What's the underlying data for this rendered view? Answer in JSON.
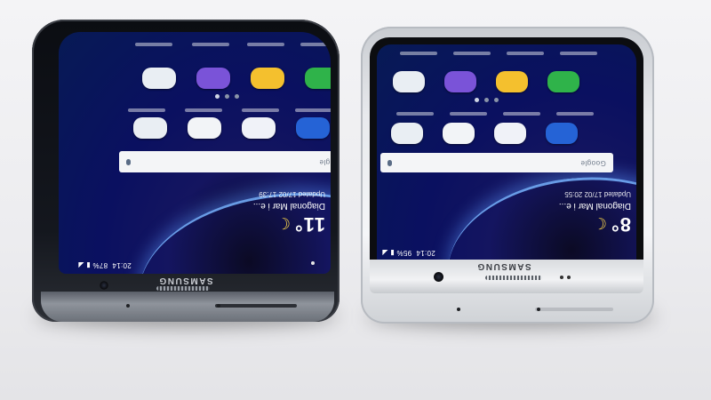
{
  "scene": {
    "description_tag": "two-smartphones-side-by-side"
  },
  "phone_left": {
    "brand": "SAMSUNG",
    "weather": {
      "temperature": "11°",
      "location": "Diagonal Mar i e...",
      "updated": "Updated 17/02 17:39"
    },
    "status": {
      "battery": "87%",
      "time": "20:14"
    },
    "search_logo": "Google",
    "icon_colors": [
      "#e9eef3",
      "#7a53d8",
      "#f4c02e",
      "#2fb34a"
    ],
    "dock_icon_colors": [
      "#e9eef3",
      "#f2f4f7",
      "#f0f2f8",
      "#2563d6"
    ]
  },
  "phone_right": {
    "brand": "SAMSUNG",
    "weather": {
      "temperature": "8°",
      "location": "Diagonal Mar i e...",
      "updated": "Updated 17/02 20:55"
    },
    "status": {
      "battery": "95%",
      "time": "20:14"
    },
    "search_logo": "Google",
    "icon_colors": [
      "#e9eef3",
      "#7a53d8",
      "#f4c02e",
      "#2fb34a"
    ],
    "dock_icon_colors": [
      "#e9eef3",
      "#f2f4f7",
      "#f0f2f8",
      "#2563d6"
    ]
  },
  "colors": {
    "background": "#eeeef1",
    "screen_blue": "#0a1060",
    "arc_highlight": "#78b4ff",
    "moon": "#f6d24a"
  }
}
